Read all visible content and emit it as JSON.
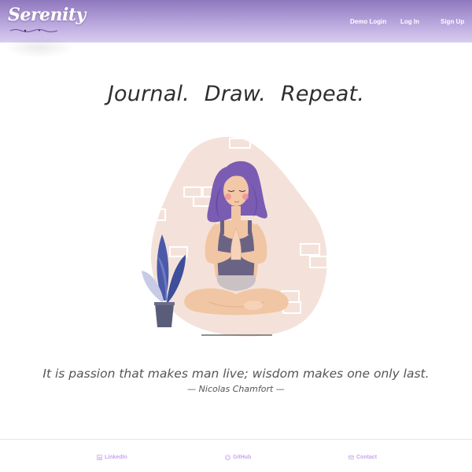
{
  "brand": {
    "name": "Serenity"
  },
  "nav": {
    "demo_login": "Demo Login",
    "log_in": "Log In",
    "sign_up": "Sign Up"
  },
  "hero": {
    "headline": "Journal.  Draw.  Repeat.",
    "illustration": "woman-meditating-illustration"
  },
  "quote": {
    "text": "It is passion that makes man live; wisdom makes one only last.",
    "author": "— Nicolas Chamfort —"
  },
  "footer": {
    "linkedin": "LinkedIn",
    "github": "GitHub",
    "contact": "Contact"
  },
  "colors": {
    "navbar_top": "#8f78bd",
    "navbar_bottom": "#d8cdf0",
    "footer_link": "#c8a7ee",
    "blob": "#f4e2da",
    "hair": "#7b5cb3",
    "plant": "#4a5aa8"
  }
}
